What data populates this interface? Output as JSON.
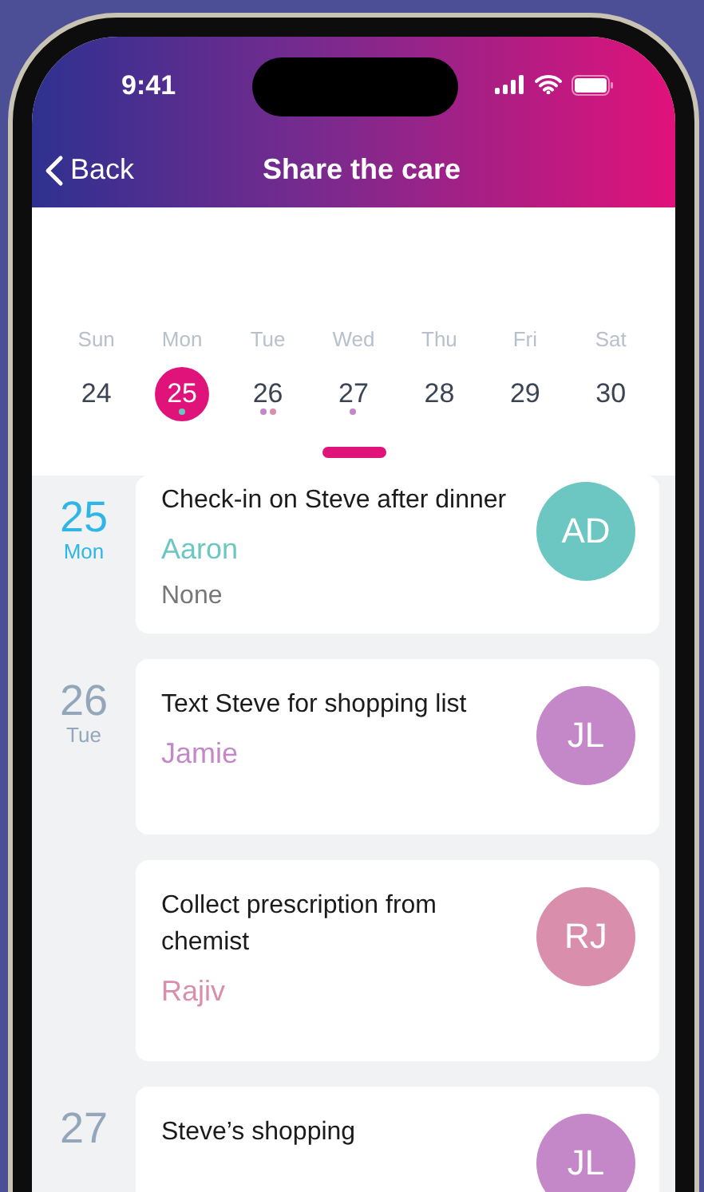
{
  "status_bar": {
    "time": "9:41"
  },
  "nav": {
    "back": "Back",
    "title": "Share the care"
  },
  "calendar": {
    "days": [
      {
        "weekday": "Sun",
        "date": "24",
        "selected": false
      },
      {
        "weekday": "Mon",
        "date": "25",
        "selected": true,
        "dots": [
          {
            "color": "#6cc7c2"
          }
        ]
      },
      {
        "weekday": "Tue",
        "date": "26",
        "selected": false,
        "dots": [
          {
            "color": "#c488c9"
          },
          {
            "color": "#d98fac"
          }
        ]
      },
      {
        "weekday": "Wed",
        "date": "27",
        "selected": false,
        "dots": [
          {
            "color": "#c488c9"
          }
        ]
      },
      {
        "weekday": "Thu",
        "date": "28",
        "selected": false
      },
      {
        "weekday": "Fri",
        "date": "29",
        "selected": false
      },
      {
        "weekday": "Sat",
        "date": "30",
        "selected": false
      }
    ]
  },
  "agenda": [
    {
      "date": "25",
      "weekday": "Mon",
      "selected": true,
      "tasks": [
        {
          "title": "Check-in on Steve after dinner",
          "assignee": "Aaron",
          "initials": "AD",
          "color": "#6cc7c2",
          "note": "None"
        }
      ]
    },
    {
      "date": "26",
      "weekday": "Tue",
      "selected": false,
      "tasks": [
        {
          "title": "Text Steve for shopping list",
          "assignee": "Jamie",
          "initials": "JL",
          "color": "#c488c9"
        },
        {
          "title": "Collect prescription from chemist",
          "assignee": "Rajiv",
          "initials": "RJ",
          "color": "#d98fac"
        }
      ]
    },
    {
      "date": "27",
      "selected": false,
      "tasks": [
        {
          "title": "Steve’s shopping",
          "initials": "JL",
          "color": "#c488c9"
        }
      ]
    }
  ]
}
